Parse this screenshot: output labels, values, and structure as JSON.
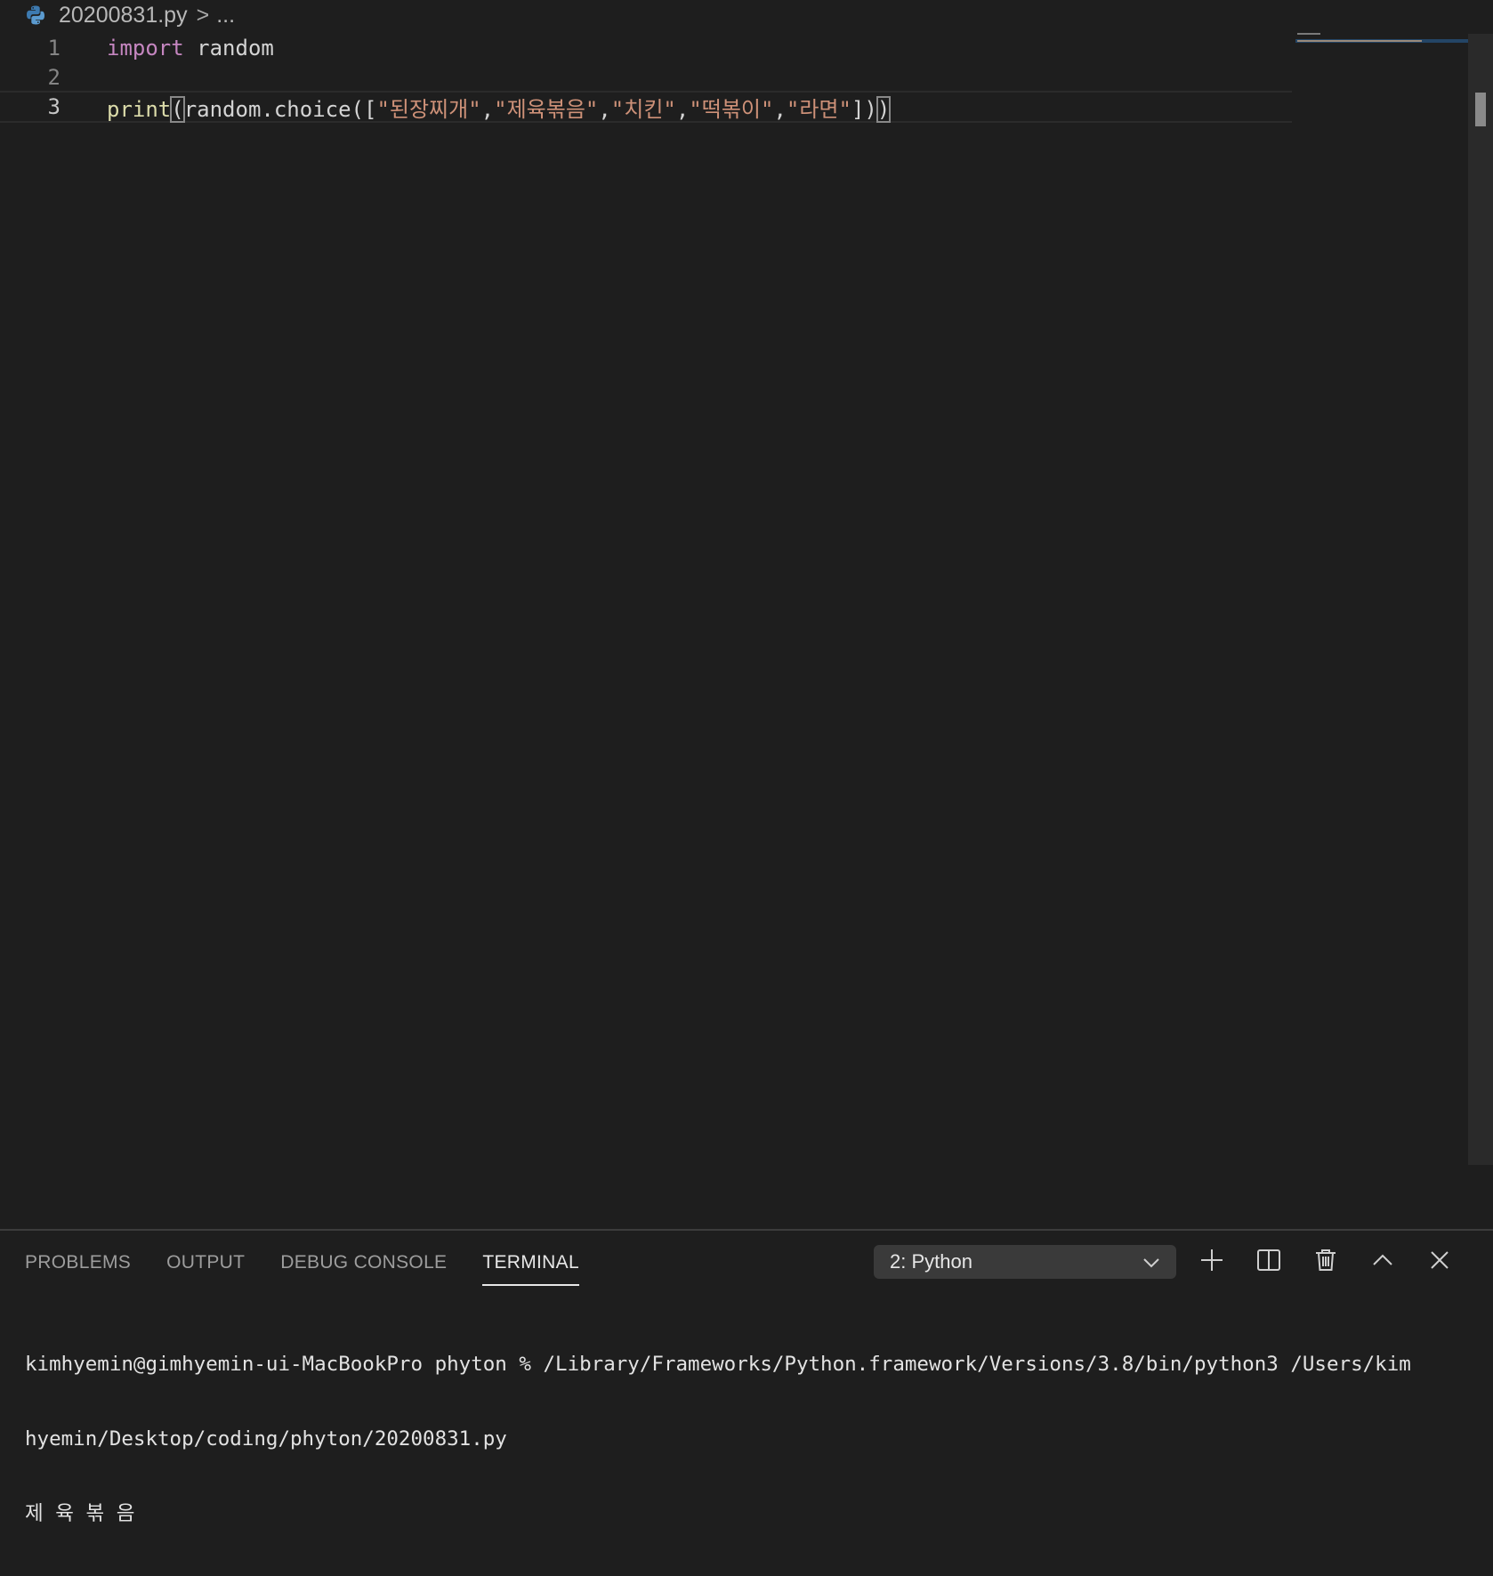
{
  "breadcrumb": {
    "file": "20200831.py",
    "separator": ">",
    "more": "..."
  },
  "editor": {
    "lines": [
      {
        "number": "1",
        "tokens": [
          {
            "type": "kw",
            "text": "import"
          },
          {
            "type": "plain",
            "text": " random"
          }
        ]
      },
      {
        "number": "2",
        "tokens": []
      },
      {
        "number": "3",
        "tokens": [
          {
            "type": "fn",
            "text": "print"
          },
          {
            "type": "plain",
            "text": "(",
            "bracket": true
          },
          {
            "type": "plain",
            "text": "random.choice(["
          },
          {
            "type": "str",
            "text": "\"된장찌개\""
          },
          {
            "type": "plain",
            "text": ","
          },
          {
            "type": "str",
            "text": "\"제육볶음\""
          },
          {
            "type": "plain",
            "text": ","
          },
          {
            "type": "str",
            "text": "\"치킨\""
          },
          {
            "type": "plain",
            "text": ","
          },
          {
            "type": "str",
            "text": "\"떡볶이\""
          },
          {
            "type": "plain",
            "text": ","
          },
          {
            "type": "str",
            "text": "\"라면\""
          },
          {
            "type": "plain",
            "text": "])"
          },
          {
            "type": "plain",
            "text": ")",
            "bracket": true
          }
        ]
      }
    ]
  },
  "panel": {
    "tabs": [
      "PROBLEMS",
      "OUTPUT",
      "DEBUG CONSOLE",
      "TERMINAL"
    ],
    "active_tab": "TERMINAL",
    "terminal_select": "2: Python",
    "actions": [
      "add-icon",
      "split-icon",
      "trash-icon",
      "chevron-up-icon",
      "close-icon"
    ]
  },
  "terminal": {
    "lines": [
      "kimhyemin@gimhyemin-ui-MacBookPro phyton % /Library/Frameworks/Python.framework/Versions/3.8/bin/python3 /Users/kim",
      "hyemin/Desktop/coding/phyton/20200831.py",
      "제 육 볶 음"
    ]
  },
  "colors": {
    "background": "#1e1e1e",
    "keyword": "#c586c0",
    "function": "#dcdcaa",
    "string": "#ce9178",
    "text": "#d4d4d4",
    "line_number": "#858585"
  }
}
